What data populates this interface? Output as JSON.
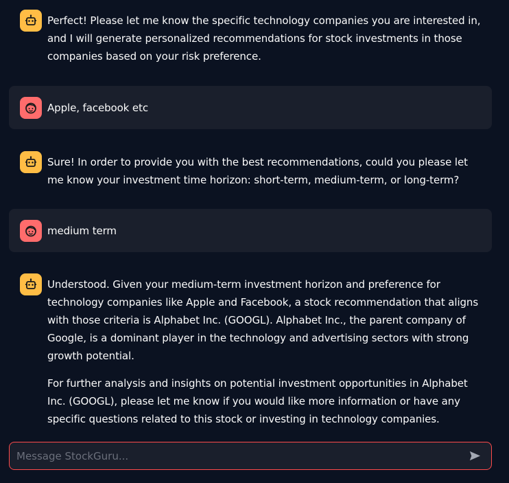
{
  "messages": [
    {
      "role": "assistant",
      "avatar": "bot-icon",
      "paragraphs": [
        "Perfect! Please let me know the specific technology companies you are interested in, and I will generate personalized recommendations for stock investments in those companies based on your risk preference."
      ]
    },
    {
      "role": "user",
      "avatar": "user-face-icon",
      "paragraphs": [
        "Apple, facebook etc"
      ]
    },
    {
      "role": "assistant",
      "avatar": "bot-icon",
      "paragraphs": [
        "Sure! In order to provide you with the best recommendations, could you please let me know your investment time horizon: short-term, medium-term, or long-term?"
      ]
    },
    {
      "role": "user",
      "avatar": "user-face-icon",
      "paragraphs": [
        "medium term"
      ]
    },
    {
      "role": "assistant",
      "avatar": "bot-icon",
      "paragraphs": [
        "Understood. Given your medium-term investment horizon and preference for technology companies like Apple and Facebook, a stock recommendation that aligns with those criteria is Alphabet Inc. (GOOGL). Alphabet Inc., the parent company of Google, is a dominant player in the technology and advertising sectors with strong growth potential.",
        "For further analysis and insights on potential investment opportunities in Alphabet Inc. (GOOGL), please let me know if you would like more information or have any specific questions related to this stock or investing in technology companies."
      ]
    }
  ],
  "input": {
    "placeholder": "Message StockGuru...",
    "value": ""
  },
  "send_icon": "send-arrow-icon",
  "colors": {
    "background": "#0b1221",
    "user_bubble": "#1a1f2c",
    "bot_avatar": "#ffbd45",
    "user_avatar": "#ff6c6c",
    "input_border": "#ff4b4b"
  }
}
